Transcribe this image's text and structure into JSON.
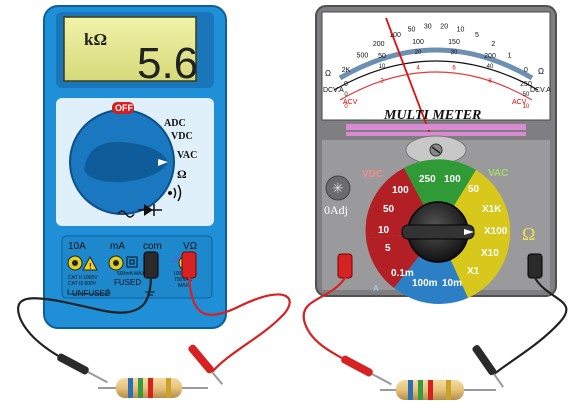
{
  "digital_meter": {
    "unit": "kΩ",
    "reading": "5.6",
    "dial_off": "OFF",
    "dial_adc": "ADC",
    "dial_vdc": "VDC",
    "dial_vac": "VAC",
    "dial_ohm": "Ω",
    "port_10a": "10A",
    "port_ma": "mA",
    "port_com": "com",
    "port_vohm": "VΩ",
    "cat_line1": "CAT II 1000V",
    "cat_line2": "CAT III 600V",
    "ma_fused": "500mA MAX",
    "fused": "FUSED",
    "v_max1": "1000VDC",
    "v_max2": "750VAC",
    "v_max3": "MAX",
    "unfused": "UNFUSED",
    "colors": {
      "body": "#1e8fd6",
      "lcd": "#e6e88e",
      "probe_red": "#d92020",
      "probe_black": "#222222"
    }
  },
  "analog_meter": {
    "title": "MULTI METER",
    "zero_adj": "0Adj",
    "scale_ohm_left": "Ω",
    "scale_ohm_right": "Ω",
    "scale_dcv": "DCV.A",
    "scale_acv": "ACV",
    "scale_dcv_right": "DCV.A",
    "scale_acv_right": "ACV",
    "ohm_ticks": [
      "2K",
      "500",
      "200",
      "100",
      "50",
      "30",
      "20",
      "10",
      "5",
      "2",
      "1",
      "0"
    ],
    "dcv_ticks": [
      "0",
      "50",
      "100",
      "150",
      "200",
      "250"
    ],
    "dcv_ticks_b": [
      "0",
      "10",
      "20",
      "30",
      "40",
      "50"
    ],
    "acv_ticks": [
      "0",
      "2",
      "4",
      "6",
      "8",
      "10"
    ],
    "sector_vdc": "VDC",
    "sector_vac": "VAC",
    "sector_ohm": "Ω",
    "vdc_values": [
      "100",
      "50",
      "10",
      "5",
      "0.1m"
    ],
    "top_values": [
      "250",
      "100",
      "50"
    ],
    "ohm_values": [
      "X1K",
      "X100",
      "X10",
      "X1"
    ],
    "bottom_values": [
      "100m",
      "10m"
    ],
    "a_label": "A",
    "colors": {
      "body": "#7e7e80",
      "face": "#ffffff",
      "needle": "#e01010",
      "vdc": "#b21f24",
      "vac": "#2f9a36",
      "ohm": "#d8c81c",
      "dca": "#2c7fc4"
    }
  },
  "resistor": {
    "bands": [
      "#2b6fb8",
      "#3a9a42",
      "#d92020",
      "#c9a227"
    ]
  }
}
